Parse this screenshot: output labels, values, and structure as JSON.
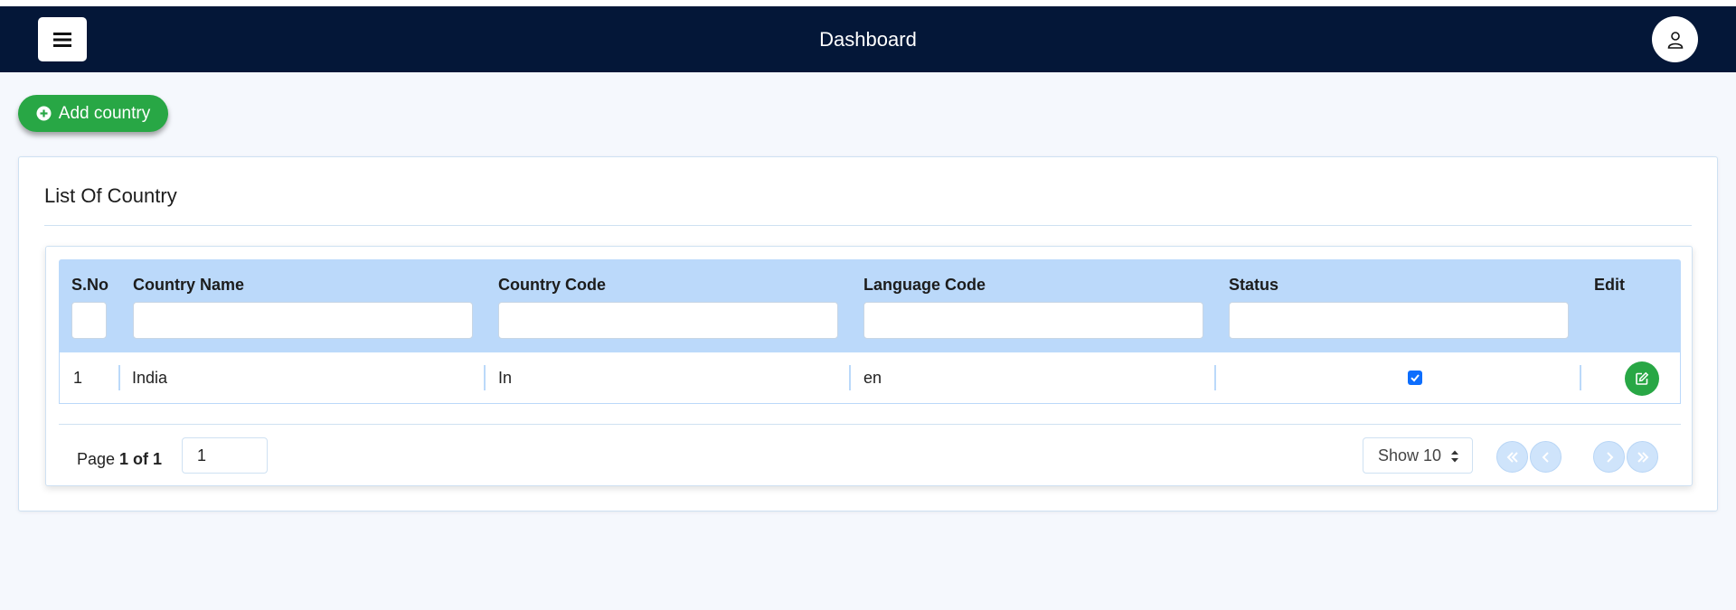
{
  "header": {
    "title": "Dashboard",
    "menu_icon": "hamburger-icon",
    "user_icon": "user-icon"
  },
  "toolbar": {
    "add_label": "Add country",
    "add_icon": "plus-circle-icon"
  },
  "card": {
    "title": "List Of Country"
  },
  "table": {
    "columns": [
      "S.No",
      "Country Name",
      "Country Code",
      "Language Code",
      "Status",
      "Edit"
    ],
    "rows": [
      {
        "sno": "1",
        "country_name": "India",
        "country_code": "In",
        "language_code": "en",
        "status_checked": true
      }
    ]
  },
  "pagination": {
    "page_prefix": "Page ",
    "page_summary": "1 of 1",
    "page_input_value": "1",
    "show_label": "Show 10"
  },
  "colors": {
    "navbar": "#041738",
    "header_row": "#bbd9fa",
    "success": "#28a745",
    "checkbox": "#0d6efd"
  }
}
